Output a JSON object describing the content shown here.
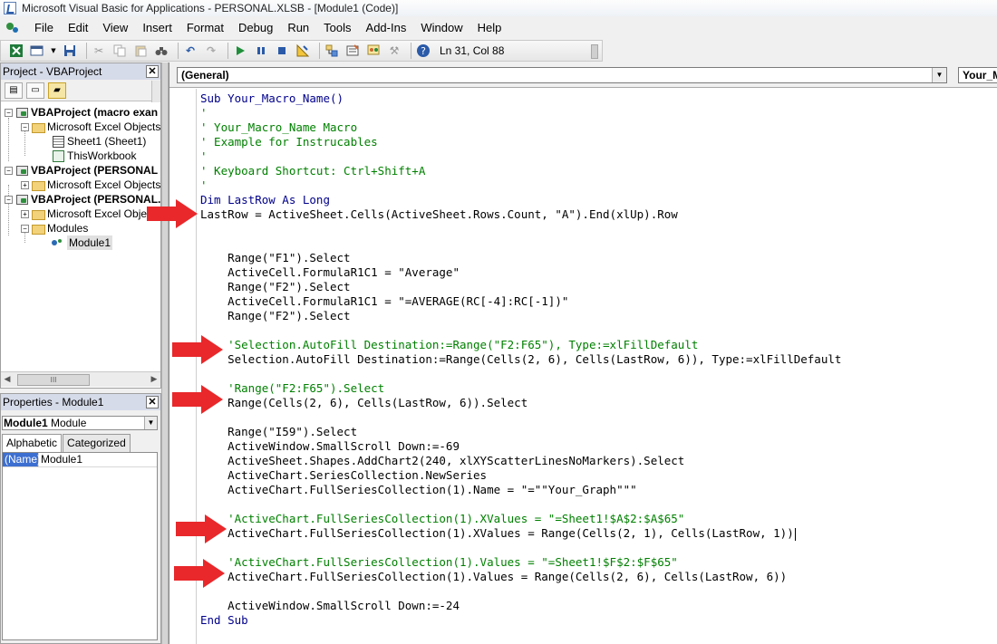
{
  "titlebar": {
    "title": "Microsoft Visual Basic for Applications - PERSONAL.XLSB - [Module1 (Code)]"
  },
  "menubar": {
    "items": [
      "File",
      "Edit",
      "View",
      "Insert",
      "Format",
      "Debug",
      "Run",
      "Tools",
      "Add-Ins",
      "Window",
      "Help"
    ]
  },
  "toolbar": {
    "position_text": "Ln 31, Col 88"
  },
  "project_pane": {
    "title": "Project - VBAProject",
    "tree": [
      {
        "label": "VBAProject (macro exan",
        "bold": true
      },
      {
        "label": "Microsoft Excel Objects"
      },
      {
        "label": "Sheet1 (Sheet1)"
      },
      {
        "label": "ThisWorkbook"
      },
      {
        "label": "VBAProject (PERSONAL (",
        "bold": true
      },
      {
        "label": "Microsoft Excel Objects"
      },
      {
        "label": "VBAProject (PERSONAL.X",
        "bold": true
      },
      {
        "label": "Microsoft Excel Objec"
      },
      {
        "label": "Modules"
      },
      {
        "label": "Module1"
      }
    ],
    "scroll_thumb": "III"
  },
  "properties_pane": {
    "title": "Properties - Module1",
    "object_name": "Module1",
    "object_type": "Module",
    "tabs": [
      "Alphabetic",
      "Categorized"
    ],
    "rows": [
      {
        "key": "(Name)",
        "value": "Module1"
      }
    ]
  },
  "code_window": {
    "object_combo": "(General)",
    "procedure_combo": "Your_M",
    "lines": [
      {
        "text": "Sub Your_Macro_Name()",
        "type": "keyword"
      },
      {
        "text": "'",
        "type": "comment"
      },
      {
        "text": "' Your_Macro_Name Macro",
        "type": "comment"
      },
      {
        "text": "' Example for Instrucables",
        "type": "comment"
      },
      {
        "text": "'",
        "type": "comment"
      },
      {
        "text": "' Keyboard Shortcut: Ctrl+Shift+A",
        "type": "comment"
      },
      {
        "text": "'",
        "type": "comment"
      },
      {
        "text": "Dim LastRow As Long",
        "type": "keyword"
      },
      {
        "text": "LastRow = ActiveSheet.Cells(ActiveSheet.Rows.Count, \"A\").End(xlUp).Row",
        "type": "normal"
      },
      {
        "text": "",
        "type": "normal"
      },
      {
        "text": "",
        "type": "normal"
      },
      {
        "text": "    Range(\"F1\").Select",
        "type": "normal"
      },
      {
        "text": "    ActiveCell.FormulaR1C1 = \"Average\"",
        "type": "normal"
      },
      {
        "text": "    Range(\"F2\").Select",
        "type": "normal"
      },
      {
        "text": "    ActiveCell.FormulaR1C1 = \"=AVERAGE(RC[-4]:RC[-1])\"",
        "type": "normal"
      },
      {
        "text": "    Range(\"F2\").Select",
        "type": "normal"
      },
      {
        "text": "",
        "type": "normal"
      },
      {
        "text": "    'Selection.AutoFill Destination:=Range(\"F2:F65\"), Type:=xlFillDefault",
        "type": "comment"
      },
      {
        "text": "    Selection.AutoFill Destination:=Range(Cells(2, 6), Cells(LastRow, 6)), Type:=xlFillDefault",
        "type": "normal"
      },
      {
        "text": "",
        "type": "normal"
      },
      {
        "text": "    'Range(\"F2:F65\").Select",
        "type": "comment"
      },
      {
        "text": "    Range(Cells(2, 6), Cells(LastRow, 6)).Select",
        "type": "normal"
      },
      {
        "text": "",
        "type": "normal"
      },
      {
        "text": "    Range(\"I59\").Select",
        "type": "normal"
      },
      {
        "text": "    ActiveWindow.SmallScroll Down:=-69",
        "type": "normal"
      },
      {
        "text": "    ActiveSheet.Shapes.AddChart2(240, xlXYScatterLinesNoMarkers).Select",
        "type": "normal"
      },
      {
        "text": "    ActiveChart.SeriesCollection.NewSeries",
        "type": "normal"
      },
      {
        "text": "    ActiveChart.FullSeriesCollection(1).Name = \"=\"\"Your_Graph\"\"\"",
        "type": "normal"
      },
      {
        "text": "",
        "type": "normal"
      },
      {
        "text": "    'ActiveChart.FullSeriesCollection(1).XValues = \"=Sheet1!$A$2:$A$65\"",
        "type": "comment"
      },
      {
        "text": "    ActiveChart.FullSeriesCollection(1).XValues = Range(Cells(2, 1), Cells(LastRow, 1))",
        "type": "normal",
        "caret": true
      },
      {
        "text": "",
        "type": "normal"
      },
      {
        "text": "    'ActiveChart.FullSeriesCollection(1).Values = \"=Sheet1!$F$2:$F$65\"",
        "type": "comment"
      },
      {
        "text": "    ActiveChart.FullSeriesCollection(1).Values = Range(Cells(2, 6), Cells(LastRow, 6))",
        "type": "normal"
      },
      {
        "text": "",
        "type": "normal"
      },
      {
        "text": "    ActiveWindow.SmallScroll Down:=-24",
        "type": "normal"
      },
      {
        "text": "End Sub",
        "type": "keyword"
      }
    ]
  },
  "colors": {
    "keyword": "#00008b",
    "comment": "#008000",
    "arrow": "#e8282b",
    "pane_header": "#d6dbe9"
  }
}
